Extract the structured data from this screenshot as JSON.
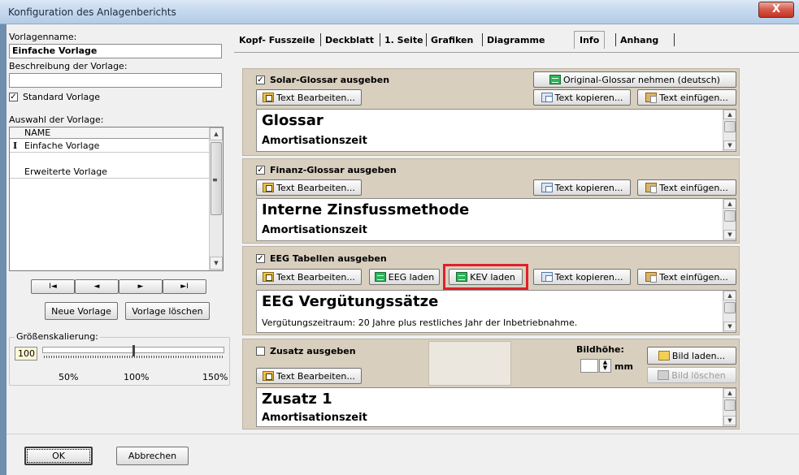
{
  "window": {
    "title": "Konfiguration des Anlagenberichts",
    "close_label": "X"
  },
  "left": {
    "template_name_label": "Vorlagenname:",
    "template_name_value": "Einfache Vorlage",
    "description_label": "Beschreibung der Vorlage:",
    "description_value": "",
    "standard_checkbox_label": "Standard Vorlage",
    "standard_checked": true,
    "selection_label": "Auswahl der Vorlage:",
    "list_header": "NAME",
    "list_items": [
      "Einfache Vorlage",
      "Erweiterte Vorlage"
    ],
    "nav_first": "I◄",
    "nav_prev": "◄",
    "nav_next": "►",
    "nav_last": "►I",
    "new_button": "Neue Vorlage",
    "delete_button": "Vorlage löschen",
    "scaling_label": "Größenskalierung:",
    "scaling_value": "100",
    "scaling_fraction": 0.5,
    "scale_ticks": [
      "50%",
      "100%",
      "150%"
    ]
  },
  "tabs": [
    {
      "label": "Kopf- Fusszeile"
    },
    {
      "label": "Deckblatt"
    },
    {
      "label": "1. Seite"
    },
    {
      "label": "Grafiken"
    },
    {
      "label": "Diagramme"
    },
    {
      "label": "Info",
      "active": true
    },
    {
      "label": "Anhang"
    }
  ],
  "sections": {
    "solar": {
      "checkbox_label": "Solar-Glossar ausgeben",
      "checked": true,
      "original_button": "Original-Glossar nehmen (deutsch)",
      "edit_button": "Text Bearbeiten...",
      "copy_button": "Text kopieren...",
      "paste_button": "Text einfügen...",
      "rtf_title": "Glossar",
      "rtf_sub": "Amortisationszeit"
    },
    "finanz": {
      "checkbox_label": "Finanz-Glossar ausgeben",
      "checked": true,
      "edit_button": "Text Bearbeiten...",
      "copy_button": "Text kopieren...",
      "paste_button": "Text einfügen...",
      "rtf_title": "Interne Zinsfussmethode",
      "rtf_sub": "Amortisationszeit"
    },
    "eeg": {
      "checkbox_label": "EEG Tabellen ausgeben",
      "checked": true,
      "edit_button": "Text Bearbeiten...",
      "eeg_button": "EEG laden",
      "kev_button": "KEV laden",
      "copy_button": "Text kopieren...",
      "paste_button": "Text einfügen...",
      "rtf_title": "EEG Vergütungssätze",
      "rtf_sub": "Vergütungszeitraum: 20 Jahre plus restliches Jahr der Inbetriebnahme."
    },
    "zusatz": {
      "checkbox_label": "Zusatz ausgeben",
      "checked": false,
      "edit_button": "Text Bearbeiten...",
      "height_label": "Bildhöhe:",
      "height_unit": "mm",
      "height_value": "",
      "load_image_button": "Bild laden...",
      "delete_image_button": "Bild löschen",
      "rtf_title": "Zusatz  1",
      "rtf_sub": "Amortisationszeit"
    }
  },
  "bottom": {
    "ok_button": "OK",
    "cancel_button": "Abbrechen"
  },
  "colors": {
    "section_bg": "#d8cfbf",
    "highlight": "#e0202a",
    "titlebar": "#c6d9ee"
  }
}
